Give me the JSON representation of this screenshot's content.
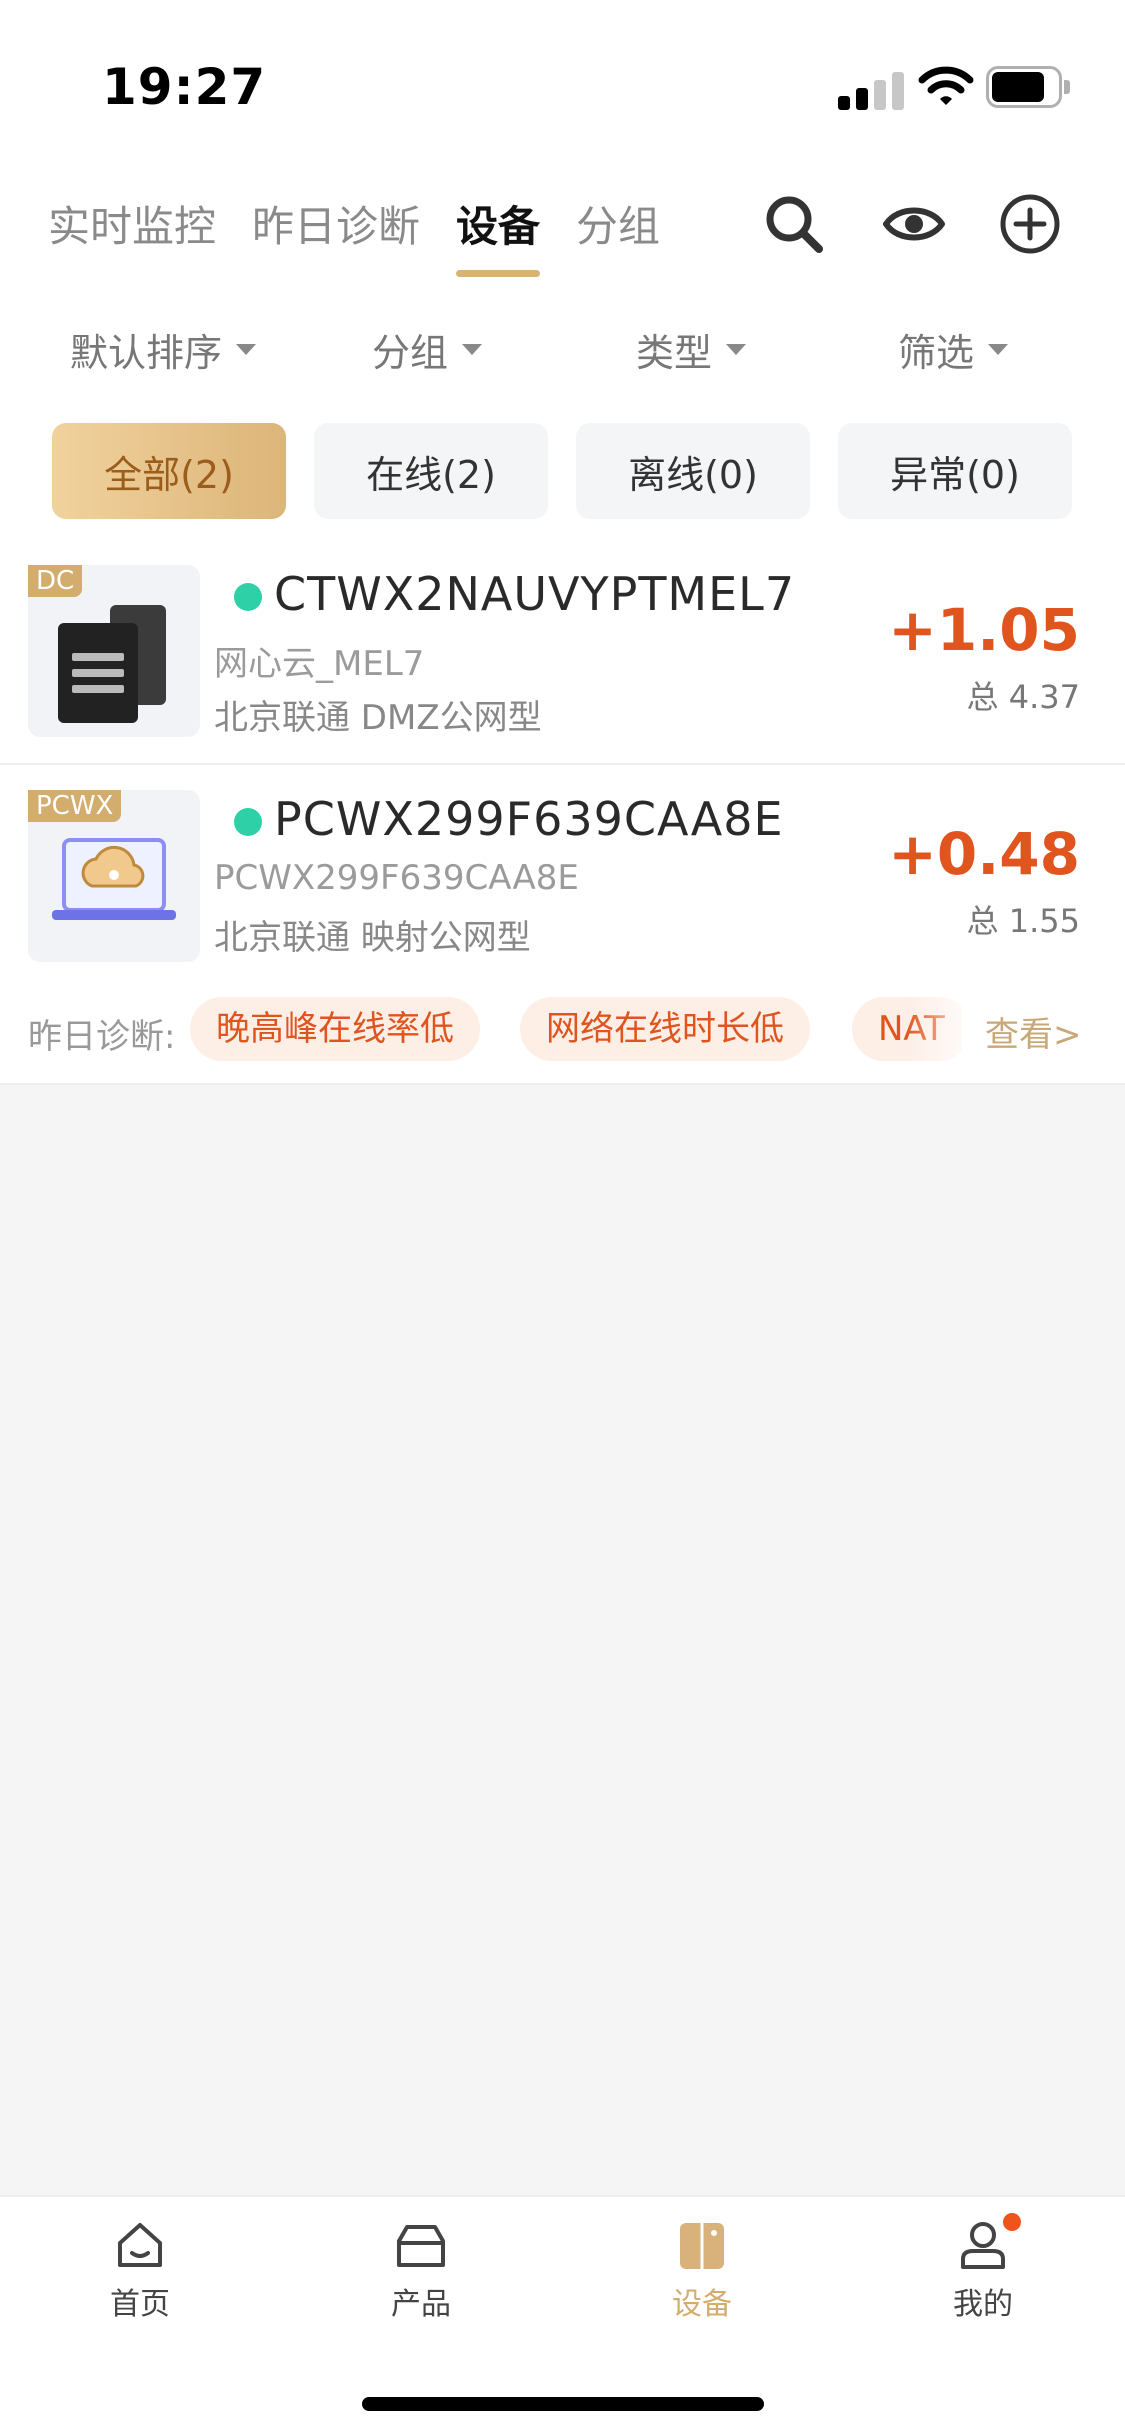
{
  "status_bar": {
    "time": "19:27"
  },
  "top_tabs": [
    {
      "label": "实时监控"
    },
    {
      "label": "昨日诊断"
    },
    {
      "label": "设备",
      "active": true
    },
    {
      "label": "分组"
    }
  ],
  "top_icons": [
    "search-icon",
    "eye-icon",
    "add-circle-icon"
  ],
  "filters": [
    {
      "label": "默认排序"
    },
    {
      "label": "分组"
    },
    {
      "label": "类型"
    },
    {
      "label": "筛选"
    }
  ],
  "status_chips": [
    {
      "label": "全部(2)",
      "active": true
    },
    {
      "label": "在线(2)"
    },
    {
      "label": "离线(0)"
    },
    {
      "label": "异常(0)"
    }
  ],
  "devices": [
    {
      "type_badge": "DC",
      "name": "CTWX2NAUVYPTMEL7",
      "subtitle": "网心云_MEL7",
      "location": "北京联通  DMZ公网型",
      "delta": "+1.05",
      "total": "总 4.37",
      "status": "online",
      "icon": "server-tower-icon"
    },
    {
      "type_badge": "PCWX",
      "name": "PCWX299F639CAA8E",
      "subtitle": "PCWX299F639CAA8E",
      "location": "北京联通  映射公网型",
      "delta": "+0.48",
      "total": "总 1.55",
      "status": "online",
      "icon": "laptop-cloud-icon"
    }
  ],
  "diagnosis": {
    "label": "昨日诊断:",
    "tags": [
      "晚高峰在线率低",
      "网络在线时长低",
      "NAT"
    ],
    "more": "查看>"
  },
  "bottom_nav": [
    {
      "label": "首页",
      "icon": "home-icon"
    },
    {
      "label": "产品",
      "icon": "box-icon"
    },
    {
      "label": "设备",
      "icon": "device-icon",
      "active": true
    },
    {
      "label": "我的",
      "icon": "user-icon",
      "has_badge": true
    }
  ],
  "colors": {
    "accent": "#d3ad6e",
    "earnings": "#e0541d",
    "online": "#2ed0a8",
    "tag_bg": "#fdeee6"
  }
}
